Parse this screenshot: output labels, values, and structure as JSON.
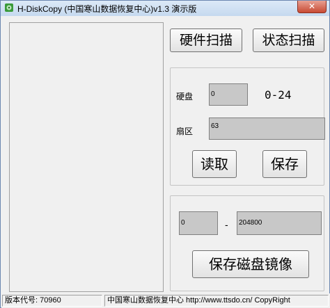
{
  "window": {
    "title": "H-DiskCopy (中国寒山数据恢复中心)v1.3 演示版",
    "close_label": "✕"
  },
  "buttons": {
    "hardware_scan": "硬件扫描",
    "status_scan": "状态扫描",
    "read": "读取",
    "save": "保存",
    "save_disk_image": "保存磁盘镜像"
  },
  "disk": {
    "disk_label": "硬盘",
    "disk_value": "0",
    "disk_range": "0-24",
    "sector_label": "扇区",
    "sector_value": "63"
  },
  "image_range": {
    "start_value": "0",
    "separator": "-",
    "end_value": "204800"
  },
  "status": {
    "version": "版本代号: 70960",
    "credit": "中国寒山数据恢复中心 http://www.ttsdo.cn/ CopyRight"
  },
  "colors": {
    "field_bg": "#c8c8c8",
    "close_red": "#c84a33"
  }
}
